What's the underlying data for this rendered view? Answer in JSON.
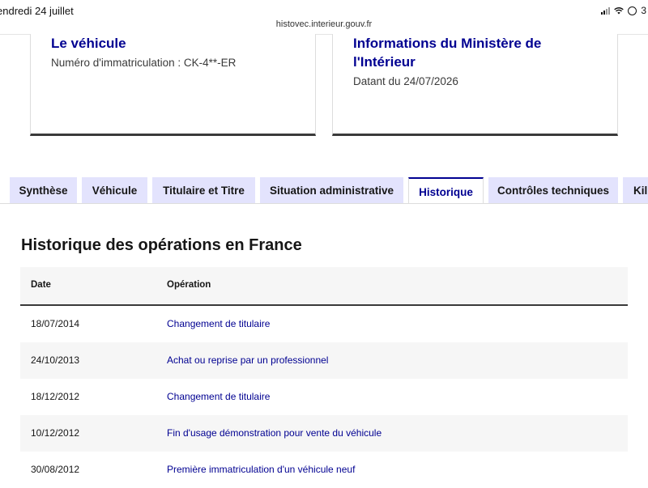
{
  "status_bar": {
    "date": "endredi 24 juillet",
    "url": "histovec.interieur.gouv.fr",
    "battery": "3"
  },
  "cards": {
    "vehicle": {
      "title": "Le véhicule",
      "subtitle": "Numéro d'immatriculation : CK-4**-ER"
    },
    "ministry": {
      "title": "Informations du Ministère de l'Intérieur",
      "subtitle": "Datant du 24/07/2026"
    }
  },
  "tabs": [
    {
      "label": "Synthèse"
    },
    {
      "label": "Véhicule"
    },
    {
      "label": "Titulaire et Titre"
    },
    {
      "label": "Situation administrative"
    },
    {
      "label": "Historique"
    },
    {
      "label": "Contrôles techniques"
    },
    {
      "label": "Kil"
    }
  ],
  "active_tab": "Historique",
  "history": {
    "title": "Historique des opérations en France",
    "columns": {
      "date": "Date",
      "operation": "Opération"
    },
    "rows": [
      {
        "date": "18/07/2014",
        "operation": "Changement de titulaire"
      },
      {
        "date": "24/10/2013",
        "operation": "Achat ou reprise par un professionnel"
      },
      {
        "date": "18/12/2012",
        "operation": "Changement de titulaire"
      },
      {
        "date": "10/12/2012",
        "operation": "Fin d'usage démonstration pour vente du véhicule"
      },
      {
        "date": "30/08/2012",
        "operation": "Première immatriculation d'un véhicule neuf"
      }
    ]
  },
  "colors": {
    "accent": "#000091",
    "tab_bg": "#e3e3fd",
    "row_alt": "#f6f6f6"
  }
}
